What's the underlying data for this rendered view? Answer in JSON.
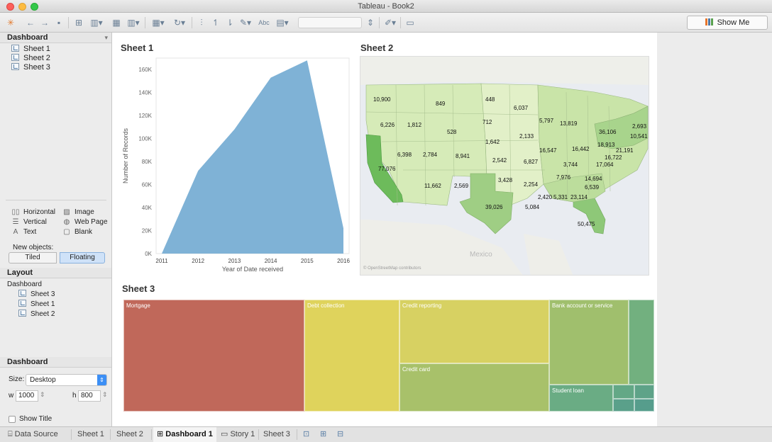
{
  "window": {
    "title": "Tableau - Book2"
  },
  "toolbar": {
    "show_me_label": "Show Me",
    "buttons": [
      "tableau-logo-icon",
      "back-icon",
      "forward-icon",
      "save-icon",
      "new-datasource-icon",
      "new-worksheet-icon",
      "duplicate-icon",
      "clear-icon",
      "swap-icon",
      "refresh-icon",
      "group-icon",
      "sort-asc-icon",
      "sort-desc-icon",
      "highlight-icon",
      "labels-icon",
      "fit-icon",
      "presentation-icon"
    ]
  },
  "left_pane": {
    "dashboard_header": "Dashboard",
    "sheets": [
      "Sheet 1",
      "Sheet 2",
      "Sheet 3"
    ],
    "objects": {
      "horizontal": "Horizontal",
      "vertical": "Vertical",
      "text": "Text",
      "image": "Image",
      "web_page": "Web Page",
      "blank": "Blank"
    },
    "new_objects_label": "New objects:",
    "tiled_label": "Tiled",
    "floating_label": "Floating",
    "layout_header": "Layout",
    "layout_root": "Dashboard",
    "layout_items": [
      "Sheet 3",
      "Sheet 1",
      "Sheet 2"
    ],
    "dashboard_section_header": "Dashboard",
    "size_label": "Size:",
    "size_value": "Desktop",
    "w_label": "w",
    "w_value": "1000",
    "h_label": "h",
    "h_value": "800",
    "show_title_label": "Show Title"
  },
  "sheet1": {
    "title": "Sheet 1",
    "chart_data": {
      "type": "area",
      "x": [
        "2011",
        "2012",
        "2013",
        "2014",
        "2015",
        "2016"
      ],
      "values": [
        0,
        72000,
        108000,
        153000,
        168000,
        22000
      ],
      "xlabel": "Year of Date received",
      "ylabel": "Number of Records",
      "ylim": [
        0,
        170000
      ],
      "yticks": [
        "0K",
        "20K",
        "40K",
        "60K",
        "80K",
        "100K",
        "120K",
        "140K",
        "160K"
      ],
      "color": "#7fb2d6"
    }
  },
  "sheet2": {
    "title": "Sheet 2",
    "states": [
      "10,900",
      "849",
      "448",
      "6,037",
      "712",
      "5,797",
      "13,819",
      "6,226",
      "1,812",
      "528",
      "36,106",
      "2,693",
      "1,642",
      "2,133",
      "10,541",
      "18,913",
      "21,191",
      "16,547",
      "16,442",
      "16,722",
      "6,398",
      "2,784",
      "8,941",
      "2,542",
      "6,827",
      "3,744",
      "17,064",
      "77,076",
      "7,976",
      "14,694",
      "3,428",
      "2,254",
      "6,539",
      "11,662",
      "2,569",
      "2,420",
      "5,331",
      "23,114",
      "39,026",
      "5,084",
      "50,475"
    ],
    "mexico_label": "Mexico",
    "attribution": "© OpenStreetMap contributors"
  },
  "sheet3": {
    "title": "Sheet 3",
    "treemap": [
      {
        "label": "Mortgage",
        "color": "#c0685a"
      },
      {
        "label": "Debt collection",
        "color": "#dfd35c"
      },
      {
        "label": "Credit reporting",
        "color": "#d7d162"
      },
      {
        "label": "Credit card",
        "color": "#a8c16a"
      },
      {
        "label": "Bank account or service",
        "color": "#a0bf6d"
      },
      {
        "label": "Student loan",
        "color": "#6aac84"
      }
    ]
  },
  "tabs": {
    "data_source": "Data Source",
    "sheet1": "Sheet 1",
    "sheet2": "Sheet 2",
    "dashboard1": "Dashboard 1",
    "story1": "Story 1",
    "sheet3": "Sheet 3"
  }
}
